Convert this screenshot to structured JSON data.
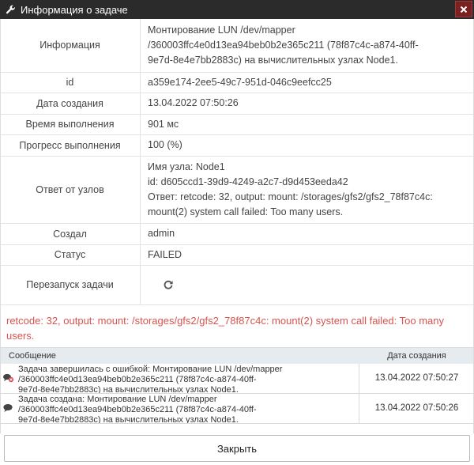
{
  "dialog": {
    "title": "Информация о задаче"
  },
  "rows": {
    "info": {
      "label": "Информация",
      "lines": [
        "Монтирование LUN /dev/mapper",
        "/360003ffc4e0d13ea94beb0b2e365c211 (78f87c4c-a874-40ff-",
        "9e7d-8e4e7bb2883c) на вычислительных узлах Node1."
      ]
    },
    "id": {
      "label": "id",
      "value": "a359e174-2ee5-49c7-951d-046c9eefcc25"
    },
    "created": {
      "label": "Дата создания",
      "value": "13.04.2022 07:50:26"
    },
    "duration": {
      "label": "Время выполнения",
      "value": "901 мс"
    },
    "progress": {
      "label": "Прогресс выполнения",
      "value": "100 (%)"
    },
    "answer": {
      "label": "Ответ от узлов",
      "lines": [
        "Имя узла: Node1",
        "id: d605ccd1-39d9-4249-a2c7-d9d453eeda42",
        "Ответ: retcode: 32, output: mount: /storages/gfs2/gfs2_78f87c4c:",
        "mount(2) system call failed: Too many users."
      ]
    },
    "creator": {
      "label": "Создал",
      "value": "admin"
    },
    "status": {
      "label": "Статус",
      "value": "FAILED"
    },
    "restart": {
      "label": "Перезапуск задачи"
    }
  },
  "error_text": "retcode: 32, output: mount: /storages/gfs2/gfs2_78f87c4c: mount(2) system call failed: Too many users.",
  "messages": {
    "col_message": "Сообщение",
    "col_date": "Дата создания",
    "items": [
      {
        "lines": [
          "Задача завершилась с ошибкой: Монтирование LUN /dev/mapper",
          "/360003ffc4e0d13ea94beb0b2e365c211 (78f87c4c-a874-40ff-",
          "9e7d-8e4e7bb2883c) на вычислительных узлах Node1."
        ],
        "date": "13.04.2022 07:50:27",
        "icon": "comment-error-icon"
      },
      {
        "lines": [
          "Задача создана: Монтирование LUN /dev/mapper",
          "/360003ffc4e0d13ea94beb0b2e365c211 (78f87c4c-a874-40ff-",
          "9e7d-8e4e7bb2883c) на вычислительных узлах Node1."
        ],
        "date": "13.04.2022 07:50:26",
        "icon": "comment-icon"
      }
    ]
  },
  "footer": {
    "close_label": "Закрыть"
  },
  "colors": {
    "titlebar": "#2b2b2b",
    "close_button": "#7a2121",
    "error": "#d9534f",
    "table_header": "#e5ebef"
  }
}
